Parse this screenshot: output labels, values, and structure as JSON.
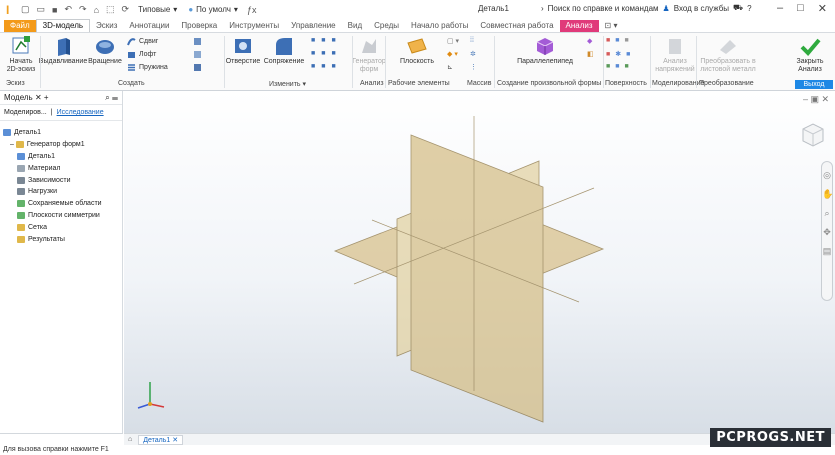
{
  "titlebar": {
    "quick_select": "Типовые",
    "material": "По умолч",
    "document_title": "Деталь1",
    "search_text": "Поиск по справке и командам",
    "signin": "Вход в службы",
    "help": "?"
  },
  "tabs": [
    "Файл",
    "3D-модель",
    "Эскиз",
    "Аннотации",
    "Проверка",
    "Инструменты",
    "Управление",
    "Вид",
    "Среды",
    "Начало работы",
    "Совместная работа",
    "Анализ"
  ],
  "ribbon": {
    "start_sketch": "Начать 2D-эскиз",
    "extrude": "Выдавливание",
    "revolve": "Вращение",
    "sweep": "Сдвиг",
    "loft": "Лофт",
    "coil": "Пружина",
    "hole": "Отверстие",
    "fillet": "Сопряжение",
    "generator": "Генератор форм",
    "plane": "Плоскость",
    "box": "Параллелепипед",
    "analysis": "Анализ напряжений",
    "convert": "Преобразовать в листовой металл",
    "close": "Закрыть Анализ",
    "panels": {
      "sketch": "Эскиз",
      "create": "Создать",
      "modify": "Изменить",
      "analysis": "Анализ",
      "work_features": "Рабочие элементы",
      "pattern": "Массив",
      "freeform": "Создание произвольной формы",
      "surface": "Поверхность",
      "simulation": "Моделирование",
      "convert": "Преобразование",
      "exit": "Выход"
    }
  },
  "browser": {
    "title": "Модель",
    "mode_modeling": "Моделиров...",
    "mode_explore": "Исследование",
    "tree": [
      {
        "label": "Деталь1",
        "indent": 0,
        "color": "#5b8fd6"
      },
      {
        "label": "Генератор форм1",
        "indent": 1,
        "color": "#e0b84a"
      },
      {
        "label": "Деталь1",
        "indent": 2,
        "color": "#5b8fd6"
      },
      {
        "label": "Материал",
        "indent": 2,
        "color": "#9aa6b2"
      },
      {
        "label": "Зависимости",
        "indent": 2,
        "color": "#7a8794"
      },
      {
        "label": "Нагрузки",
        "indent": 2,
        "color": "#7a8794"
      },
      {
        "label": "Сохраняемые области",
        "indent": 2,
        "color": "#63b36a"
      },
      {
        "label": "Плоскости симметрии",
        "indent": 2,
        "color": "#63b36a"
      },
      {
        "label": "Сетка",
        "indent": 2,
        "color": "#e0b84a"
      },
      {
        "label": "Результаты",
        "indent": 2,
        "color": "#e0b84a"
      }
    ]
  },
  "viewport": {
    "plane_color": "#c8b27a",
    "accent": "#f39a1a"
  },
  "document_tab": "Деталь1",
  "status": "Для вызова справки нажмите F1",
  "watermark": "PCPROGS.NET"
}
